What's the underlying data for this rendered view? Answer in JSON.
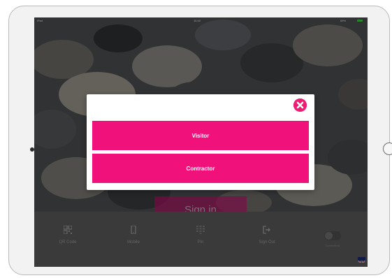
{
  "status_bar": {
    "carrier": "iPad",
    "time": "16:40",
    "battery": "69%"
  },
  "main": {
    "signin_label": "Sign in"
  },
  "modal": {
    "close_icon": "times-circle-icon",
    "visitor_label": "Visitor",
    "contractor_label": "Contractor"
  },
  "bottom_nav": {
    "items": [
      {
        "label": "QR Code",
        "icon": "qr-code-icon"
      },
      {
        "label": "Mobile",
        "icon": "mobile-phone-icon"
      },
      {
        "label": "Pin",
        "icon": "keypad-icon"
      },
      {
        "label": "Sign Out",
        "icon": "sign-out-icon"
      }
    ],
    "toggle_label": "Contactless"
  },
  "colors": {
    "accent": "#f0127a",
    "accent_dim": "#c70b6e",
    "overlay": "rgba(0,0,0,0.35)"
  }
}
